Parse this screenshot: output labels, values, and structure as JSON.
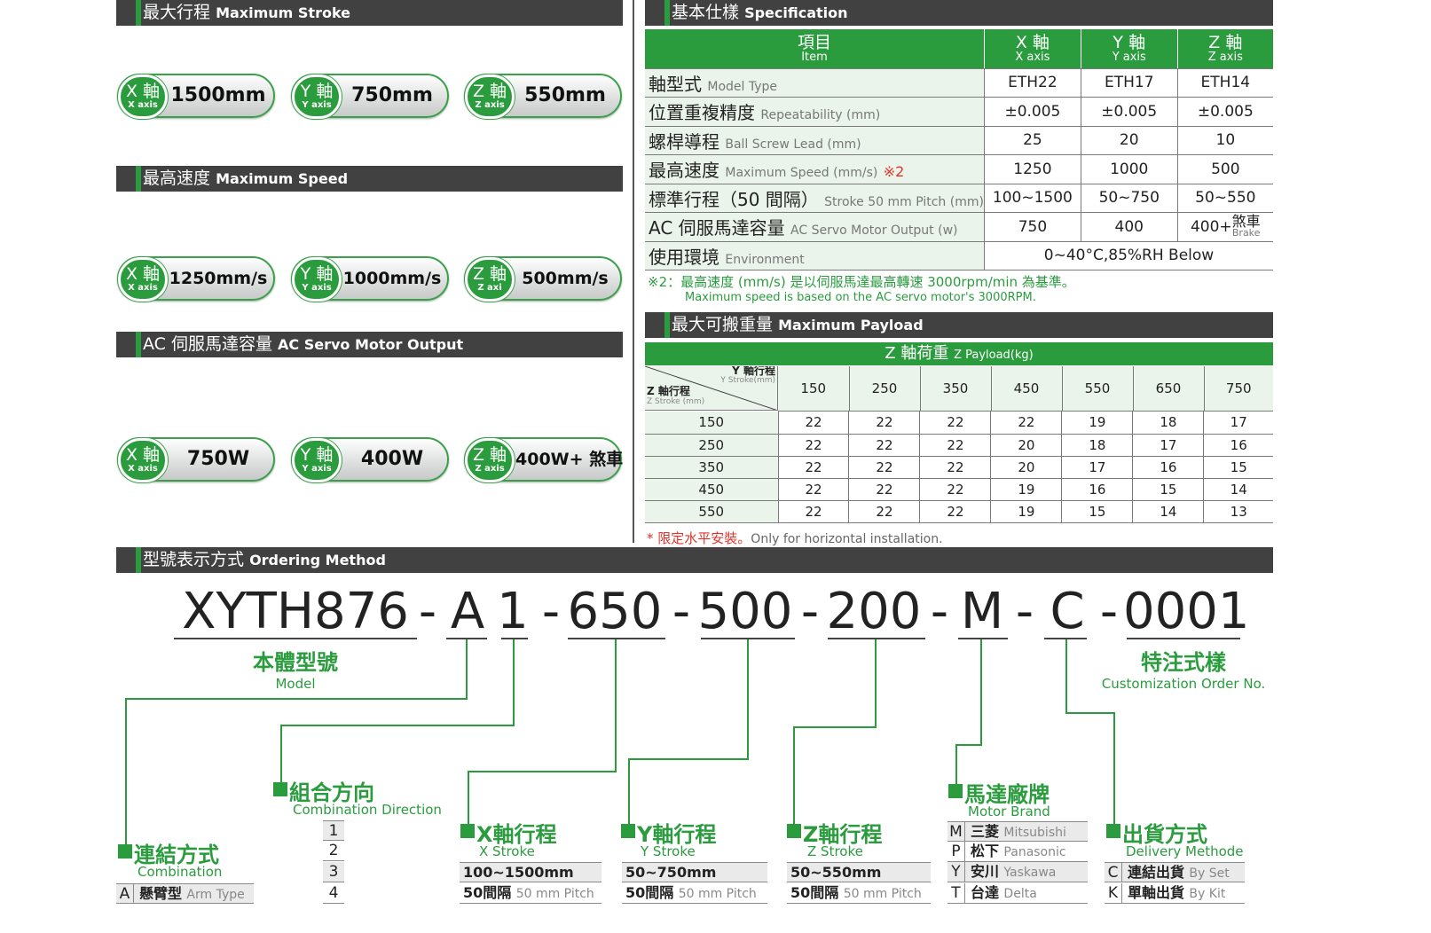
{
  "sections": {
    "max_stroke": {
      "zh": "最大行程",
      "en": "Maximum Stroke"
    },
    "max_speed": {
      "zh": "最高速度",
      "en": "Maximum Speed"
    },
    "servo": {
      "zh": "AC 伺服馬達容量",
      "en": "AC Servo Motor Output"
    },
    "spec": {
      "zh": "基本仕樣",
      "en": "Specification"
    },
    "payload": {
      "zh": "最大可搬重量",
      "en": "Maximum Payload"
    },
    "ordering": {
      "zh": "型號表示方式",
      "en": "Ordering Method"
    }
  },
  "pills": {
    "stroke": [
      {
        "zh": "X 軸",
        "en": "X axis",
        "value": "1500mm"
      },
      {
        "zh": "Y 軸",
        "en": "Y axis",
        "value": "750mm"
      },
      {
        "zh": "Z 軸",
        "en": "Z axis",
        "value": "550mm"
      }
    ],
    "speed": [
      {
        "zh": "X 軸",
        "en": "X axis",
        "value": "1250mm/s"
      },
      {
        "zh": "Y 軸",
        "en": "Y axis",
        "value": "1000mm/s"
      },
      {
        "zh": "Z 軸",
        "en": "Z axi",
        "value": "500mm/s"
      }
    ],
    "servo": [
      {
        "zh": "X 軸",
        "en": "X axis",
        "value": "750W"
      },
      {
        "zh": "Y 軸",
        "en": "Y axis",
        "value": "400W"
      },
      {
        "zh": "Z 軸",
        "en": "Z axis",
        "value": "400W+ 煞車"
      }
    ]
  },
  "spec_table": {
    "header": [
      {
        "zh": "項目",
        "en": "Item"
      },
      {
        "zh": "X 軸",
        "en": "X axis"
      },
      {
        "zh": "Y 軸",
        "en": "Y axis"
      },
      {
        "zh": "Z 軸",
        "en": "Z axis"
      }
    ],
    "rows": [
      {
        "zh": "軸型式",
        "en": "Model Type",
        "x": "ETH22",
        "y": "ETH17",
        "z": "ETH14"
      },
      {
        "zh": "位置重複精度",
        "en": "Repeatability (mm)",
        "x": "±0.005",
        "y": "±0.005",
        "z": "±0.005"
      },
      {
        "zh": "螺桿導程",
        "en": "Ball Screw Lead (mm)",
        "x": "25",
        "y": "20",
        "z": "10"
      },
      {
        "zh": "最高速度",
        "en": "Maximum Speed (mm/s)",
        "note": "※2",
        "x": "1250",
        "y": "1000",
        "z": "500"
      },
      {
        "zh": "標準行程（50 間隔）",
        "en": "Stroke 50 mm Pitch (mm)",
        "x": "100~1500",
        "y": "50~750",
        "z": "50~550"
      },
      {
        "zh": "AC 伺服馬達容量",
        "en": "AC Servo Motor Output (w)",
        "x": "750",
        "y": "400",
        "z": "400+",
        "z_zh": "煞車",
        "z_en": "Brake"
      }
    ],
    "env": {
      "zh": "使用環境",
      "en": "Environment",
      "value": "0~40°C,85%RH Below"
    },
    "note_zh": "※2：最高速度 (mm/s) 是以伺服馬達最高轉速 3000rpm/min 為基準。",
    "note_en": "Maximum speed is based on the AC servo motor's 3000RPM."
  },
  "payload_table": {
    "title_zh": "Z 軸荷重",
    "title_en": "Z Payload(kg)",
    "y_label_zh": "Y 軸行程",
    "y_label_en": "Y Stroke(mm)",
    "z_label_zh": "Z 軸行程",
    "z_label_en": "Z Stroke (mm)",
    "columns": [
      "150",
      "250",
      "350",
      "450",
      "550",
      "650",
      "750"
    ],
    "rows": [
      {
        "z": "150",
        "v": [
          "22",
          "22",
          "22",
          "22",
          "19",
          "18",
          "17"
        ]
      },
      {
        "z": "250",
        "v": [
          "22",
          "22",
          "22",
          "20",
          "18",
          "17",
          "16"
        ]
      },
      {
        "z": "350",
        "v": [
          "22",
          "22",
          "22",
          "20",
          "17",
          "16",
          "15"
        ]
      },
      {
        "z": "450",
        "v": [
          "22",
          "22",
          "22",
          "19",
          "16",
          "15",
          "14"
        ]
      },
      {
        "z": "550",
        "v": [
          "22",
          "22",
          "22",
          "19",
          "15",
          "14",
          "13"
        ]
      }
    ],
    "note_star": "*",
    "note_zh": "限定水平安裝。",
    "note_en": "Only for horizontal installation."
  },
  "ordering": {
    "code": [
      "XYTH876",
      "-",
      "A",
      "1",
      "-",
      "650",
      "-",
      "500",
      "-",
      "200",
      "-",
      "M",
      "-",
      "C",
      "-",
      "0001"
    ],
    "model": {
      "zh": "本體型號",
      "en": "Model"
    },
    "custom": {
      "zh": "特注式樣",
      "en": "Customization Order No."
    },
    "combination_dir": {
      "zh": "組合方向",
      "en": "Combination Direction",
      "items": [
        "1",
        "2",
        "3",
        "4"
      ]
    },
    "combination": {
      "zh": "連結方式",
      "en": "Combination",
      "items": [
        {
          "k": "A",
          "zh": "懸臂型",
          "en": "Arm Type"
        }
      ]
    },
    "x_stroke": {
      "zh": "X軸行程",
      "en": "X Stroke",
      "range": "100~1500mm",
      "pitch_zh": "50間隔",
      "pitch_en": "50 mm Pitch"
    },
    "y_stroke": {
      "zh": "Y軸行程",
      "en": "Y Stroke",
      "range": "50~750mm",
      "pitch_zh": "50間隔",
      "pitch_en": "50 mm Pitch"
    },
    "z_stroke": {
      "zh": "Z軸行程",
      "en": "Z Stroke",
      "range": "50~550mm",
      "pitch_zh": "50間隔",
      "pitch_en": "50 mm Pitch"
    },
    "motor": {
      "zh": "馬達廠牌",
      "en": "Motor Brand",
      "items": [
        {
          "k": "M",
          "zh": "三菱",
          "en": "Mitsubishi"
        },
        {
          "k": "P",
          "zh": "松下",
          "en": "Panasonic"
        },
        {
          "k": "Y",
          "zh": "安川",
          "en": "Yaskawa"
        },
        {
          "k": "T",
          "zh": "台達",
          "en": "Delta"
        }
      ]
    },
    "delivery": {
      "zh": "出貨方式",
      "en": "Delivery Methode",
      "items": [
        {
          "k": "C",
          "zh": "連結出貨",
          "en": "By Set"
        },
        {
          "k": "K",
          "zh": "單軸出貨",
          "en": "By Kit"
        }
      ]
    }
  }
}
